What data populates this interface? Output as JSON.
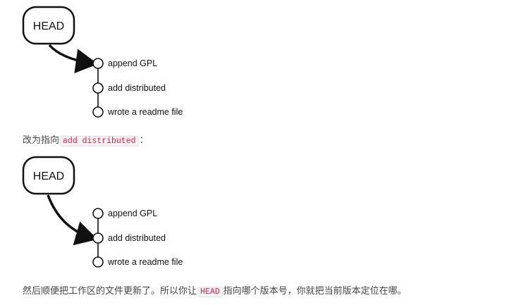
{
  "diagram1": {
    "head_label": "HEAD",
    "commits": [
      "append GPL",
      "add distributed",
      "wrote a readme file"
    ],
    "head_points_to": "append GPL"
  },
  "caption1": {
    "prefix": "改为指向",
    "code": "add distributed",
    "suffix": "："
  },
  "diagram2": {
    "head_label": "HEAD",
    "commits": [
      "append GPL",
      "add distributed",
      "wrote a readme file"
    ],
    "head_points_to": "add distributed"
  },
  "caption2": {
    "prefix": "然后顺便把工作区的文件更新了。所以你让",
    "code": "HEAD",
    "suffix": "指向哪个版本号，你就把当前版本定位在哪。"
  }
}
